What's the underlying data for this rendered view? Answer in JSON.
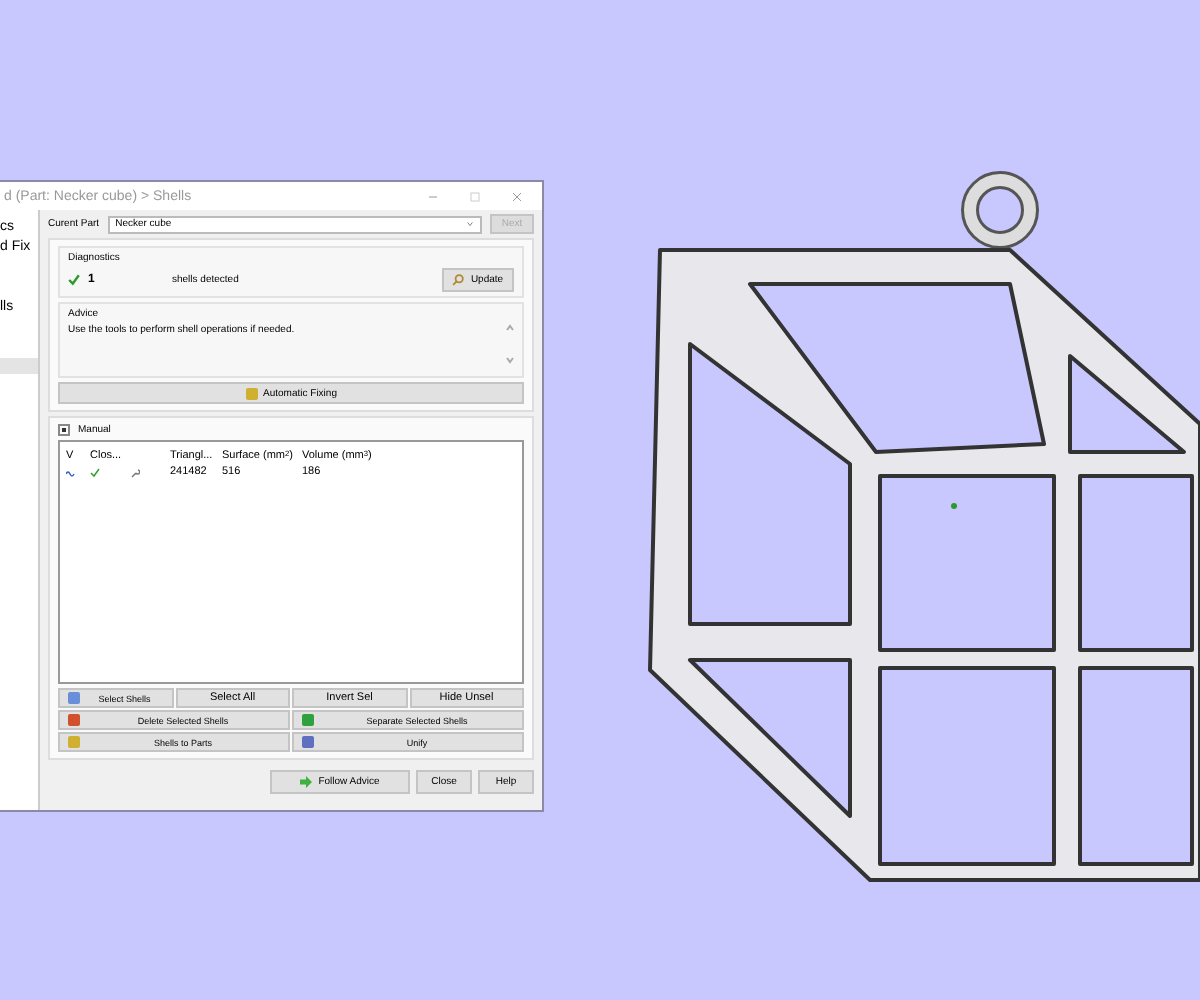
{
  "window": {
    "title": "d (Part: Necker cube) > Shells"
  },
  "sidebar": {
    "items": [
      {
        "label": "cs"
      },
      {
        "label": "d Fix"
      },
      {
        "label": "lls"
      }
    ]
  },
  "current_part": {
    "label": "Curent Part",
    "value": "Necker cube",
    "next_button": {
      "label": "Next",
      "disabled": true
    }
  },
  "diagnostics": {
    "title": "Diagnostics",
    "count": "1",
    "text": "shells detected",
    "update_button": "Update"
  },
  "advice": {
    "title": "Advice",
    "text": "Use the tools to perform shell operations if needed."
  },
  "automatic_fixing_button": "Automatic Fixing",
  "manual": {
    "label": "Manual",
    "expanded": true
  },
  "table": {
    "columns": [
      "V",
      "Clos...",
      "",
      "Triangl...",
      "Surface (mm$^{2}$)",
      "Volume (mm$^{3}$)"
    ],
    "rows": [
      {
        "visible": true,
        "closed": true,
        "cells": [
          "",
          "",
          "",
          "241482",
          "516",
          "186"
        ]
      }
    ]
  },
  "tool_buttons": [
    [
      {
        "label": "Select Shells"
      },
      {
        "label": "Select All"
      },
      {
        "label": "Invert Sel"
      },
      {
        "label": "Hide Unsel"
      }
    ],
    [
      {
        "label": "Delete Selected Shells"
      },
      {
        "label": "Separate Selected Shells"
      }
    ],
    [
      {
        "label": "Shells to Parts"
      },
      {
        "label": "Unify"
      }
    ]
  ],
  "footer_buttons": [
    {
      "label": "Follow Advice"
    },
    {
      "label": "Close"
    },
    {
      "label": "Help"
    }
  ]
}
